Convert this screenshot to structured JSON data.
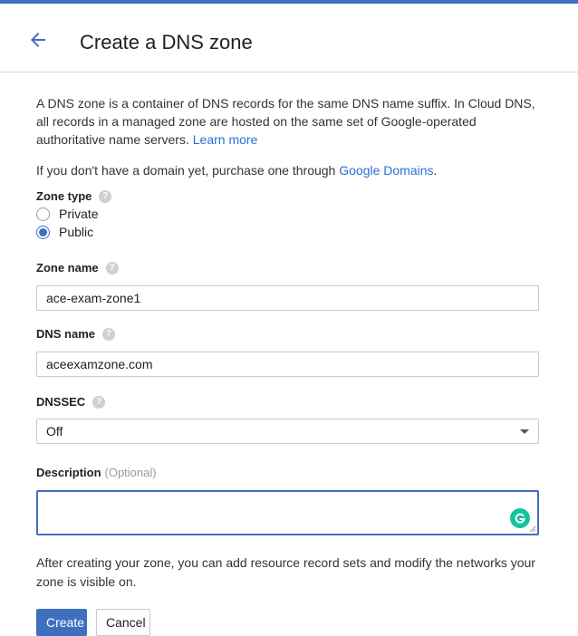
{
  "header": {
    "title": "Create a DNS zone",
    "back_icon": "arrow-left-icon"
  },
  "intro": {
    "text": "A DNS zone is a container of DNS records for the same DNS name suffix. In Cloud DNS, all records in a managed zone are hosted on the same set of Google-operated authoritative name servers.",
    "link": "Learn more"
  },
  "domains_note": {
    "text": "If you don't have a domain yet, purchase one through",
    "link": "Google Domains",
    "suffix": "."
  },
  "zone_type": {
    "label": "Zone type",
    "options": [
      "Private",
      "Public"
    ],
    "selected": "Public"
  },
  "zone_name": {
    "label": "Zone name",
    "value": "ace-exam-zone1"
  },
  "dns_name": {
    "label": "DNS name",
    "value": "aceexamzone.com"
  },
  "dnssec": {
    "label": "DNSSEC",
    "value": "Off"
  },
  "description": {
    "label": "Description",
    "optional": "(Optional)",
    "value": ""
  },
  "footer_note": "After creating your zone, you can add resource record sets and modify the networks your zone is visible on.",
  "buttons": {
    "create": "Create",
    "cancel": "Cancel"
  },
  "colors": {
    "accent": "#3f6fbf",
    "link": "#2a6fd1",
    "grammarly": "#15c39a"
  }
}
